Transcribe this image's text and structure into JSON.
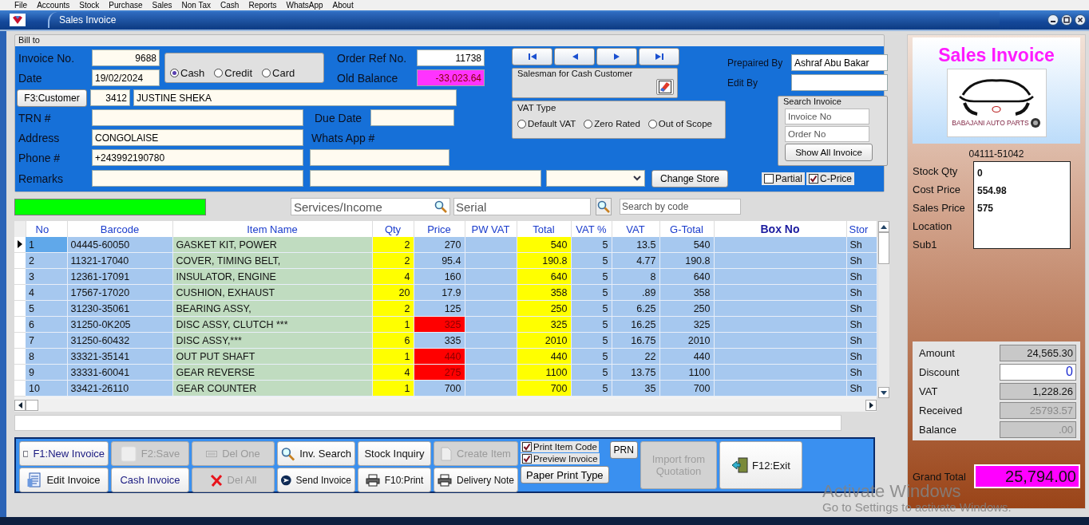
{
  "menu": [
    "File",
    "Accounts",
    "Stock",
    "Purchase",
    "Sales",
    "Non Tax",
    "Cash",
    "Reports",
    "WhatsApp",
    "About"
  ],
  "window": {
    "title": "Sales Invoice"
  },
  "bill_to": {
    "legend": "Bill to",
    "invoice_no": {
      "label": "Invoice No.",
      "value": "9688"
    },
    "date": {
      "label": "Date",
      "value": "19/02/2024"
    },
    "payment": [
      {
        "label": "Cash",
        "selected": true
      },
      {
        "label": "Credit",
        "selected": false
      },
      {
        "label": "Card",
        "selected": false
      }
    ],
    "order_ref": {
      "label": "Order Ref No.",
      "value": "11738"
    },
    "old_balance": {
      "label": "Old Balance",
      "value": "-33,023.64"
    },
    "customer": {
      "button": "F3:Customer",
      "code": "3412",
      "name": "JUSTINE SHEKA"
    },
    "trn": {
      "label": "TRN #"
    },
    "due_date": {
      "label": "Due Date"
    },
    "address": {
      "label": "Address",
      "value": "CONGOLAISE"
    },
    "whatsapp": {
      "label": "Whats App #"
    },
    "phone": {
      "label": "Phone #",
      "value": "+243992190780"
    },
    "remarks": {
      "label": "Remarks"
    },
    "change_store": "Change Store",
    "salesman_title": "Salesman for Cash Customer",
    "vat_type": {
      "title": "VAT Type",
      "options": [
        {
          "label": "Default VAT",
          "selected": false
        },
        {
          "label": "Zero Rated",
          "selected": false
        },
        {
          "label": "Out of Scope",
          "selected": false
        }
      ]
    },
    "prepared_by": {
      "label": "Prepaired By",
      "value": "Ashraf Abu Bakar"
    },
    "edit_by": {
      "label": "Edit By"
    },
    "search_invoice": {
      "title": "Search Invoice",
      "invoice_placeholder": "Invoice No",
      "order_placeholder": "Order No",
      "button": "Show All Invoice"
    },
    "options": [
      {
        "label": "Partial",
        "checked": false
      },
      {
        "label": "C-Price",
        "checked": true
      }
    ]
  },
  "search_bar": {
    "services_placeholder": "Services/Income",
    "serial_placeholder": "Serial",
    "code_placeholder": "Search by code"
  },
  "table": {
    "columns": [
      {
        "label": "No",
        "kind": "index"
      },
      {
        "label": "Barcode",
        "kind": "text"
      },
      {
        "label": "Item Name",
        "kind": "name"
      },
      {
        "label": "Qty",
        "kind": "entry"
      },
      {
        "label": "Price",
        "kind": "price"
      },
      {
        "label": "PW VAT",
        "kind": "number"
      },
      {
        "label": "Total",
        "kind": "entry"
      },
      {
        "label": "VAT %",
        "kind": "number"
      },
      {
        "label": "VAT",
        "kind": "number"
      },
      {
        "label": "G-Total",
        "kind": "number"
      },
      {
        "label": "Box No",
        "kind": "box"
      },
      {
        "label": "Stor",
        "kind": "text"
      }
    ],
    "rows": [
      {
        "selected": true,
        "price_flagged": false,
        "cells": [
          "1",
          "04445-60050",
          "GASKET KIT, POWER",
          "2",
          "270",
          null,
          "540",
          "5",
          "13.5",
          "540",
          null,
          "Sh"
        ]
      },
      {
        "selected": false,
        "price_flagged": false,
        "cells": [
          "2",
          "11321-17040",
          "COVER, TIMING BELT,",
          "2",
          "95.4",
          null,
          "190.8",
          "5",
          "4.77",
          "190.8",
          null,
          "Sh"
        ]
      },
      {
        "selected": false,
        "price_flagged": false,
        "cells": [
          "3",
          "12361-17091",
          "INSULATOR, ENGINE",
          "4",
          "160",
          null,
          "640",
          "5",
          "8",
          "640",
          null,
          "Sh"
        ]
      },
      {
        "selected": false,
        "price_flagged": false,
        "cells": [
          "4",
          "17567-17020",
          "CUSHION, EXHAUST",
          "20",
          "17.9",
          null,
          "358",
          "5",
          ".89",
          "358",
          null,
          "Sh"
        ]
      },
      {
        "selected": false,
        "price_flagged": false,
        "cells": [
          "5",
          "31230-35061",
          "BEARING ASSY,",
          "2",
          "125",
          null,
          "250",
          "5",
          "6.25",
          "250",
          null,
          "Sh"
        ]
      },
      {
        "selected": false,
        "price_flagged": true,
        "cells": [
          "6",
          "31250-0K205",
          "DISC ASSY, CLUTCH ***",
          "1",
          "325",
          null,
          "325",
          "5",
          "16.25",
          "325",
          null,
          "Sh"
        ]
      },
      {
        "selected": false,
        "price_flagged": false,
        "cells": [
          "7",
          "31250-60432",
          "DISC ASSY,***",
          "6",
          "335",
          null,
          "2010",
          "5",
          "16.75",
          "2010",
          null,
          "Sh"
        ]
      },
      {
        "selected": false,
        "price_flagged": true,
        "cells": [
          "8",
          "33321-35141",
          "OUT PUT SHAFT",
          "1",
          "440",
          null,
          "440",
          "5",
          "22",
          "440",
          null,
          "Sh"
        ]
      },
      {
        "selected": false,
        "price_flagged": true,
        "cells": [
          "9",
          "33331-60041",
          "GEAR REVERSE",
          "4",
          "275",
          null,
          "1100",
          "5",
          "13.75",
          "1100",
          null,
          "Sh"
        ]
      },
      {
        "selected": false,
        "price_flagged": false,
        "cells": [
          "10",
          "33421-26110",
          "GEAR COUNTER",
          "1",
          "700",
          null,
          "700",
          "5",
          "35",
          "700",
          null,
          "Sh"
        ]
      }
    ]
  },
  "toolbar": {
    "buttons": [
      [
        {
          "label": "F1:New Invoice",
          "disabled": false
        },
        {
          "label": "Edit Invoice",
          "disabled": false
        }
      ],
      [
        {
          "label": "F2:Save",
          "disabled": true
        },
        {
          "label": "Cash Invoice",
          "disabled": false
        }
      ],
      [
        {
          "label": "Del One",
          "disabled": true
        },
        {
          "label": "Del All",
          "disabled": true
        }
      ],
      [
        {
          "label": "Inv. Search",
          "disabled": false
        },
        {
          "label": "Send Invoice",
          "disabled": false
        }
      ],
      [
        {
          "label": "Stock Inquiry",
          "disabled": false
        },
        {
          "label": "F10:Print",
          "disabled": false
        }
      ],
      [
        {
          "label": "Create Item",
          "disabled": true
        },
        {
          "label": "Delivery Note",
          "disabled": false
        }
      ]
    ],
    "print_options": [
      {
        "label": "Print Item Code",
        "checked": true
      },
      {
        "label": "Preview Invoice",
        "checked": true
      }
    ],
    "paper_print_type": "Paper Print Type",
    "prn": "PRN",
    "import": {
      "label": "Import from Quotation",
      "disabled": true
    },
    "exit": {
      "label": "F12:Exit",
      "disabled": false
    }
  },
  "side": {
    "title": "Sales Invoice",
    "brand": "BABAJANI AUTO PARTS",
    "item_code": "04111-51042",
    "stock": [
      {
        "label": "Stock Qty",
        "value": "0"
      },
      {
        "label": "Cost Price",
        "value": "554.98"
      },
      {
        "label": "Sales Price",
        "value": "575"
      },
      {
        "label": "Location"
      },
      {
        "label": "Sub1"
      }
    ],
    "totals": [
      {
        "label": "Amount",
        "value": "24,565.30",
        "kind": "readonly"
      },
      {
        "label": "Discount",
        "value": "0",
        "kind": "input"
      },
      {
        "label": "VAT",
        "value": "1,228.26",
        "kind": "readonly"
      },
      {
        "label": "Received",
        "value": "25793.57",
        "kind": "muted"
      },
      {
        "label": "Balance",
        "value": ".00",
        "kind": "muted"
      }
    ],
    "grand_total": {
      "label": "Grand Total",
      "value": "25,794.00"
    }
  },
  "overlay": {
    "title": "Activate Windows",
    "subtitle": "Go to Settings to activate Windows."
  }
}
